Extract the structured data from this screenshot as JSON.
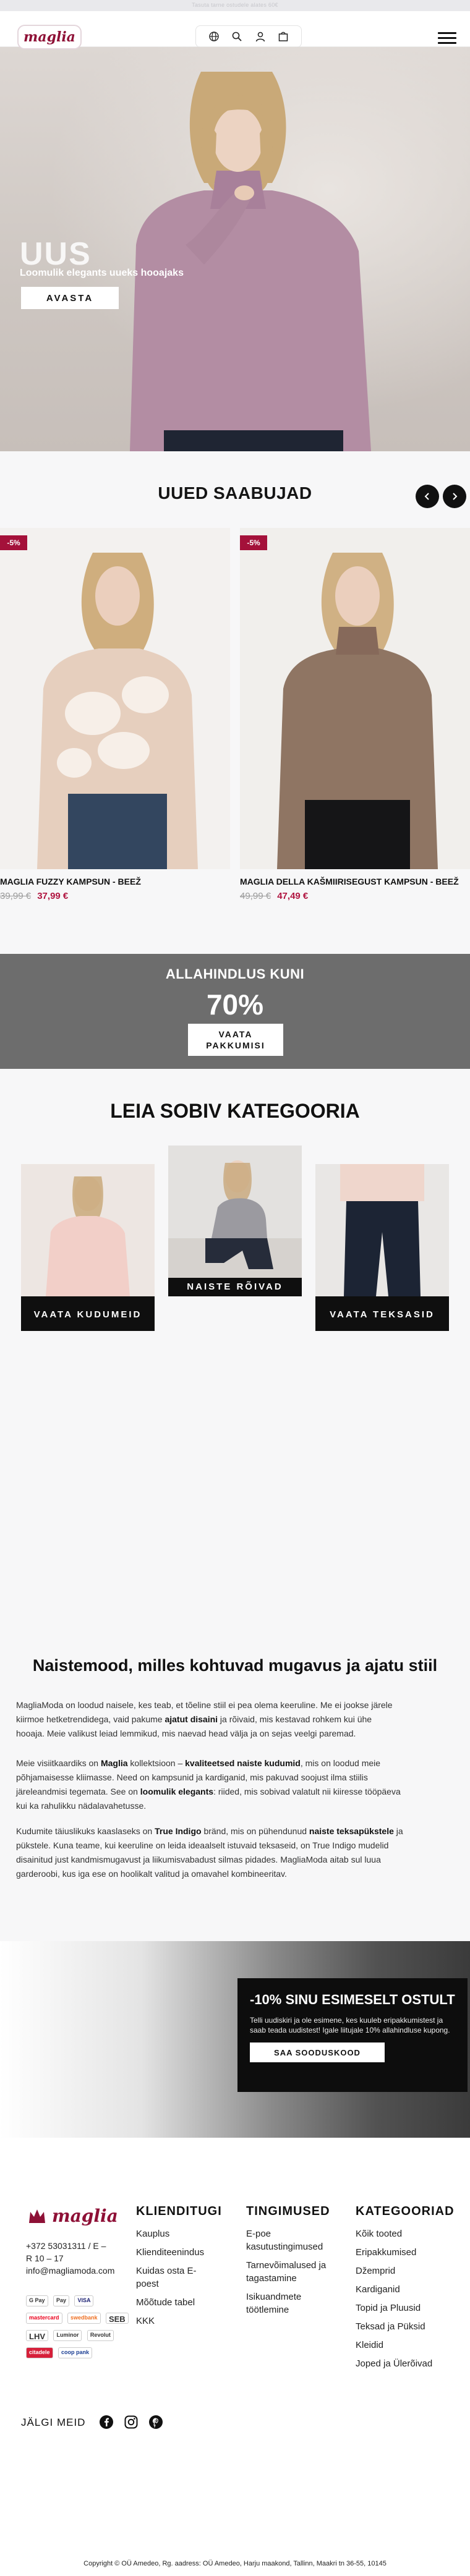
{
  "topbar": {
    "text": "Tasuta tarne ostudele alates 60€"
  },
  "header": {
    "logo": "maglia",
    "icons": [
      "globe-icon",
      "search-icon",
      "account-icon",
      "bag-icon"
    ],
    "menu_icon": "hamburger-icon"
  },
  "hero": {
    "title": "UUS",
    "subtitle": "Loomulik elegants uueks hooajaks",
    "button": "AVASTA"
  },
  "new_arrivals": {
    "title": "UUED SAABUJAD",
    "products": [
      {
        "badge": "-5%",
        "name": "MAGLIA FUZZY KAMPSUN - BEEŽ",
        "old_price": "39,99 €",
        "new_price": "37,99 €"
      },
      {
        "badge": "-5%",
        "name": "MAGLIA DELLA KAŠMIIRISEGUST KAMPSUN - BEEŽ",
        "old_price": "49,99 €",
        "new_price": "47,49 €"
      }
    ]
  },
  "sale_banner": {
    "line1": "ALLAHINDLUS KUNI",
    "line2": "70%",
    "button": "VAATA PAKKUMISI"
  },
  "categories": {
    "title": "LEIA SOBIV KATEGOORIA",
    "items": [
      {
        "label": "VAATA KUDUMEID"
      },
      {
        "label": "NAISTE RÕIVAD"
      },
      {
        "label": "VAATA TEKSASID"
      }
    ]
  },
  "about": {
    "title": "Naistemood, milles kohtuvad mugavus ja ajatu stiil",
    "p1": [
      "MagliaModa on loodud naisele, kes teab, et tõeline stiil ei pea olema keeruline. Me ei jookse järele",
      "kiirmoe hetketrendidega, vaid pakume ",
      "ajatut disaini",
      " ja rõivaid, mis kestavad rohkem kui ühe",
      "hooaja. Meie valikust leiad lemmikud, mis naevad head välja ja on sejas veelgi paremad."
    ],
    "p2": [
      "Meie visiitkaardiks on ",
      "Maglia",
      " kollektsioon – ",
      "kvaliteetsed naiste kudumid",
      ", mis on loodud meie",
      "põhjamaisesse kliimasse. Need on kampsunid ja kardiganid, mis pakuvad soojust ilma stiilis",
      "järeleandmisi tegemata. See on ",
      "loomulik elegants",
      ": riided, mis sobivad valatult nii kiiresse tööpäeva",
      "kui ka rahulikku nädalavahetusse."
    ],
    "p3": [
      "Kudumite täiuslikuks kaaslaseks on ",
      "True Indigo",
      " bränd, mis on pühendunud ",
      "naiste teksapükstele",
      " ja",
      "pükstele. Kuna teame, kui keeruline on leida ideaalselt istuvaid teksaseid, on True Indigo mudelid",
      "disainitud just kandmismugavust ja liikumisvabadust silmas pidades. MagliaModa aitab sul luua",
      "garderoobi, kus iga ese on hoolikalt valitud ja omavahel kombineeritav."
    ]
  },
  "promo": {
    "title": "-10% SINU ESIMESELT OSTULT",
    "description": "Telli uudiskiri ja ole esimene, kes kuuleb eripakkumistest ja saab teada uudistest! Igale liitujale 10% allahindluse kupong.",
    "button": "SAA SOODUSKOOD"
  },
  "footer": {
    "logo": "maglia",
    "phone": "+372 53031311 / E –",
    "hours": "R 10 – 17",
    "email": "info@magliamoda.com",
    "payments": [
      "G Pay",
      "Pay",
      "VISA",
      "mastercard",
      "swedbank",
      "SEB",
      "LHV",
      "Luminor",
      "Revolut",
      "citadele",
      "coop pank"
    ],
    "columns": [
      {
        "title": "KLIENDITUGI",
        "links": [
          "Kauplus",
          "Klienditeenindus",
          "Kuidas osta E-poest",
          "Mõõtude tabel",
          "KKK"
        ]
      },
      {
        "title": "TINGIMUSED",
        "links": [
          "E-poe kasutustingimused",
          "Tarnevõimalused ja tagastamine",
          "Isikuandmete töötlemine"
        ]
      },
      {
        "title": "KATEGOORIAD",
        "links": [
          "Kõik tooted",
          "Eripakkumised",
          "Džemprid",
          "Kardiganid",
          "Topid ja Pluusid",
          "Teksad ja Püksid",
          "Kleidid",
          "Joped ja Ülerõivad"
        ]
      }
    ],
    "follow": "JÄLGI MEID",
    "socials": [
      "facebook-icon",
      "instagram-icon",
      "pinterest-icon"
    ],
    "copyright": "Copyright © OÜ Amedeo, Rg. aadress: OÜ Amedeo, Harju maakond, Tallinn, Maakri tn 36-55, 10145"
  },
  "colors": {
    "brand": "#8e1036",
    "sale": "#b01540",
    "dark": "#0f0f0f"
  }
}
